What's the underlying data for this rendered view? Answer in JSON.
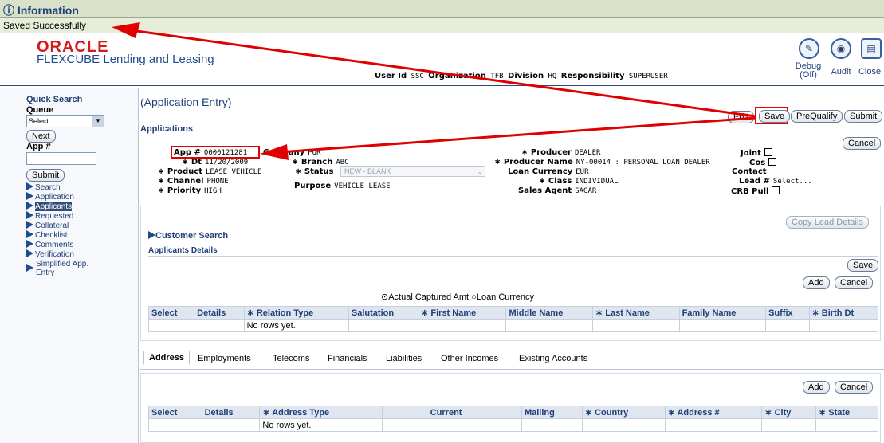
{
  "info": {
    "title": "Information",
    "message": "Saved Successfully"
  },
  "header": {
    "brand": "ORACLE",
    "product": "FLEXCUBE Lending and Leasing",
    "userline": {
      "user_label": "User Id",
      "user_value": "SSC",
      "org_label": "Organization",
      "org_value": "TFB",
      "div_label": "Division",
      "div_value": "HQ",
      "resp_label": "Responsibility",
      "resp_value": "SUPERUSER"
    },
    "icons": {
      "debug_label": "Debug",
      "debug_state": "(Off)",
      "audit_label": "Audit",
      "close_label": "Close"
    }
  },
  "sidebar": {
    "title": "Quick Search",
    "queue_label": "Queue",
    "queue_selected": "Select...",
    "next_button": "Next",
    "app_label": "App #",
    "submit_button": "Submit",
    "links": [
      "Search",
      "Application",
      "Applicants",
      "Requested",
      "Collateral",
      "Checklist",
      "Comments",
      "Verification",
      "Simplified App.",
      "Entry"
    ]
  },
  "main": {
    "title": "(Application Entry)",
    "section": "Applications",
    "buttons": {
      "edit": "Edit",
      "save": "Save",
      "prequalify": "PreQualify",
      "submit": "Submit",
      "cancel": "Cancel"
    },
    "fields": {
      "app_no_label": "App #",
      "app_no": "0000121281",
      "dt_label": "Dt",
      "dt": "11/20/2009",
      "product_label": "Product",
      "product": "LEASE VEHICLE",
      "channel_label": "Channel",
      "channel": "PHONE",
      "priority_label": "Priority",
      "priority": "HIGH",
      "company_label": "Company",
      "company": "PQR",
      "branch_label": "Branch",
      "branch": "ABC",
      "status_label": "Status",
      "status": "NEW - BLANK",
      "purpose_label": "Purpose",
      "purpose": "VEHICLE LEASE",
      "producer_label": "Producer",
      "producer": "DEALER",
      "producer_name_label": "Producer Name",
      "producer_name": "NY-00014 : PERSONAL LOAN DEALER",
      "loan_currency_label": "Loan Currency",
      "loan_currency": "EUR",
      "class_label": "Class",
      "class": "INDIVIDUAL",
      "sales_agent_label": "Sales Agent",
      "sales_agent": "SAGAR",
      "joint_label": "Joint",
      "cos_label": "Cos",
      "contact_label": "Contact",
      "lead_label": "Lead #",
      "lead": "Select...",
      "crb_label": "CRB Pull"
    }
  },
  "applicants": {
    "copy_lead": "Copy Lead Details",
    "customer_search": "Customer Search",
    "title": "Applicants Details",
    "save": "Save",
    "add": "Add",
    "cancel": "Cancel",
    "radio_actual": "Actual Captured Amt",
    "radio_loan": "Loan Currency",
    "columns": [
      "Select",
      "Details",
      "∗ Relation Type",
      "Salutation",
      "∗ First Name",
      "Middle Name",
      "∗ Last Name",
      "Family Name",
      "Suffix",
      "∗ Birth Dt"
    ],
    "empty": "No rows yet."
  },
  "tabs": [
    "Address",
    "Employments",
    "Telecoms",
    "Financials",
    "Liabilities",
    "Other Incomes",
    "Existing Accounts"
  ],
  "address": {
    "add": "Add",
    "cancel": "Cancel",
    "columns": [
      "Select",
      "Details",
      "∗ Address Type",
      "Current",
      "Mailing",
      "∗ Country",
      "∗ Address #",
      "∗ City",
      "∗ State"
    ],
    "empty": "No rows yet."
  },
  "colors": {
    "accent": "#1f3f78",
    "highlight": "#e00000",
    "info_bg": "#d9e2c9"
  }
}
